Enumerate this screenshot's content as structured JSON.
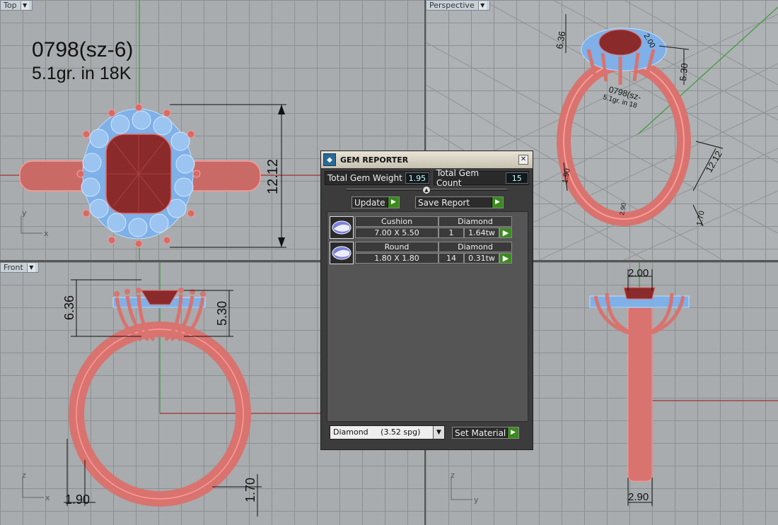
{
  "viewports": {
    "top": {
      "label": "Top",
      "title_line1": "0798(sz-6)",
      "title_line2": "5.1gr.  in 18K",
      "dim_height": "12.12",
      "axis_y": "y",
      "axis_x": "x"
    },
    "perspective": {
      "label": "Perspective",
      "dim_a": "6.36",
      "dim_b": "2.00",
      "dim_c": "5.30",
      "dim_d": "12.12",
      "dim_e": "1.90",
      "dim_f": "2.90",
      "dim_g": "1.70",
      "engraving": "0798(sz-",
      "engraving2": "5.1gr.  in 18"
    },
    "front": {
      "label": "Front",
      "dim_height": "6.36",
      "dim_setting": "5.30",
      "dim_band": "1.90",
      "dim_base": "1.70",
      "axis_z": "z",
      "axis_x": "x"
    },
    "right": {
      "dim_top": "2.00",
      "dim_bottom": "2.90",
      "axis_z": "z",
      "axis_y": "y"
    }
  },
  "gem_reporter": {
    "title": "GEM REPORTER",
    "close": "✕",
    "total_weight_label": "Total Gem Weight",
    "total_weight_value": "1.95",
    "total_count_label": "Total Gem Count",
    "total_count_value": "15",
    "update_label": "Update",
    "save_report_label": "Save Report",
    "gems": [
      {
        "shape": "Cushion",
        "material": "Diamond",
        "size": "7.00 X 5.50",
        "count": "1",
        "weight": "1.64tw"
      },
      {
        "shape": "Round",
        "material": "Diamond",
        "size": "1.80 X 1.80",
        "count": "14",
        "weight": "0.31tw"
      }
    ],
    "material_select": "Diamond     (3.52 spg)",
    "set_material_label": "Set Material"
  },
  "colors": {
    "metal": "#d8736f",
    "gem": "#8b2a2a",
    "halo": "#7fb0e8",
    "dimension": "#111111"
  }
}
